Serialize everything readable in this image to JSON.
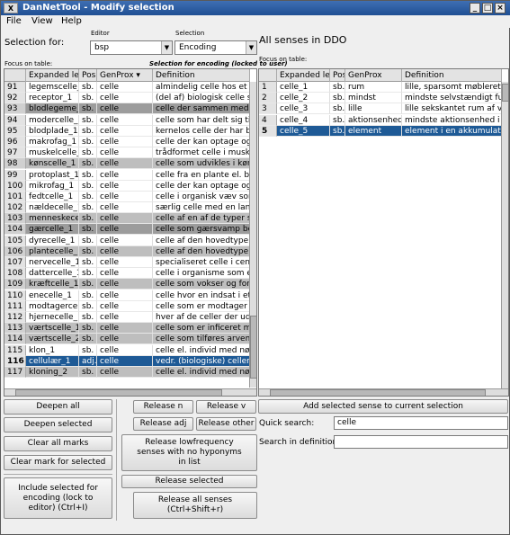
{
  "window": {
    "title": "DanNetTool - Modify selection"
  },
  "menu": [
    "File",
    "View",
    "Help"
  ],
  "left": {
    "selection_for_label": "Selection for:",
    "editor_label": "Editor",
    "editor_value": "bsp",
    "selection_label": "Selection",
    "selection_value": "Encoding",
    "focus_label": "Focus on table:",
    "lock_label": "Selection for encoding (locked to user)",
    "columns": [
      "",
      "Expanded le",
      "Pos",
      "GenProx",
      "Definition"
    ],
    "rows": [
      {
        "n": "91",
        "exp": "legemscelle_1",
        "pos": "sb.",
        "gen": "celle",
        "def": "almindelig celle hos et mer",
        "st": ""
      },
      {
        "n": "92",
        "exp": "receptor_1",
        "pos": "sb.",
        "gen": "celle",
        "def": "(del af) biologisk celle som",
        "st": ""
      },
      {
        "n": "93",
        "exp": "blodlegeme_1",
        "pos": "sb.",
        "gen": "celle",
        "def": "celle der sammen med blo",
        "st": "d"
      },
      {
        "n": "94",
        "exp": "modercelle_1",
        "pos": "sb.",
        "gen": "celle",
        "def": "celle som har delt sig til ny",
        "st": ""
      },
      {
        "n": "95",
        "exp": "blodplade_1",
        "pos": "sb.",
        "gen": "celle",
        "def": "kernelos celle der har bety",
        "st": ""
      },
      {
        "n": "96",
        "exp": "makrofag_1",
        "pos": "sb.",
        "gen": "celle",
        "def": "celle der kan optage og fje",
        "st": ""
      },
      {
        "n": "97",
        "exp": "muskelcelle_1",
        "pos": "sb.",
        "gen": "celle",
        "def": "trådformet celle i muskelv",
        "st": ""
      },
      {
        "n": "98",
        "exp": "kønscelle_1",
        "pos": "sb.",
        "gen": "celle",
        "def": "celle som udvikles i kønski",
        "st": "g"
      },
      {
        "n": "99",
        "exp": "protoplast_1",
        "pos": "sb.",
        "gen": "celle",
        "def": "celle fra en plante el. bakte",
        "st": ""
      },
      {
        "n": "100",
        "exp": "mikrofag_1",
        "pos": "sb.",
        "gen": "celle",
        "def": "celle der kan optage og us",
        "st": ""
      },
      {
        "n": "101",
        "exp": "fedtcelle_1",
        "pos": "sb.",
        "gen": "celle",
        "def": "celle i organisk væv som k",
        "st": ""
      },
      {
        "n": "102",
        "exp": "nældecelle_1",
        "pos": "sb.",
        "gen": "celle",
        "def": "særlig celle med en lang (c",
        "st": ""
      },
      {
        "n": "103",
        "exp": "menneskecel",
        "pos": "sb.",
        "gen": "celle",
        "def": "celle af en af de typer som",
        "st": "g"
      },
      {
        "n": "104",
        "exp": "gærcelle_1",
        "pos": "sb.",
        "gen": "celle",
        "def": "celle som gærsvamp bestå",
        "st": "d"
      },
      {
        "n": "105",
        "exp": "dyrecelle_1",
        "pos": "sb.",
        "gen": "celle",
        "def": "celle af den hovedtype som",
        "st": ""
      },
      {
        "n": "106",
        "exp": "plantecelle_1",
        "pos": "sb.",
        "gen": "celle",
        "def": "celle af den hovedtype som",
        "st": "g"
      },
      {
        "n": "107",
        "exp": "nervecelle_1",
        "pos": "sb.",
        "gen": "celle",
        "def": "specialiseret celle i centra",
        "st": ""
      },
      {
        "n": "108",
        "exp": "dattercelle_1",
        "pos": "sb.",
        "gen": "celle",
        "def": "celle i organisme som e",
        "st": ""
      },
      {
        "n": "109",
        "exp": "kræftcelle_1",
        "pos": "sb.",
        "gen": "celle",
        "def": "celle som vokser og forme",
        "st": "g"
      },
      {
        "n": "110",
        "exp": "enecelle_1",
        "pos": "sb.",
        "gen": "celle",
        "def": "celle hvor en indsat i et fo",
        "st": ""
      },
      {
        "n": "111",
        "exp": "modtagercelle",
        "pos": "sb.",
        "gen": "celle",
        "def": "celle som er modtager af a",
        "st": ""
      },
      {
        "n": "112",
        "exp": "hjernecelle_1",
        "pos": "sb.",
        "gen": "celle",
        "def": "hver af de celler der udgø",
        "st": ""
      },
      {
        "n": "113",
        "exp": "værtscelle_1",
        "pos": "sb.",
        "gen": "celle",
        "def": "celle som er inficeret med",
        "st": "g"
      },
      {
        "n": "114",
        "exp": "værtscelle_2",
        "pos": "sb.",
        "gen": "celle",
        "def": "celle som tilføres arvemate",
        "st": "g"
      },
      {
        "n": "115",
        "exp": "klon_1",
        "pos": "sb.",
        "gen": "celle",
        "def": "celle el. individ med nøjagt",
        "st": ""
      },
      {
        "n": "116",
        "exp": "cellulær_1",
        "pos": "adj.",
        "gen": "celle",
        "def": "vedr. (biologiske) celler",
        "st": "s"
      },
      {
        "n": "117",
        "exp": "kloning_2",
        "pos": "sb.",
        "gen": "celle",
        "def": "celle el. individ med nøjagt",
        "st": "g"
      }
    ]
  },
  "right": {
    "title": "All senses in DDO",
    "focus_label": "Focus on table:",
    "columns": [
      "",
      "Expanded le",
      "Pos",
      "GenProx",
      "Definition"
    ],
    "rows": [
      {
        "n": "1",
        "exp": "celle_1",
        "pos": "sb.",
        "gen": "rum",
        "def": "lille, sparsomt møbleret rum b",
        "st": ""
      },
      {
        "n": "2",
        "exp": "celle_2",
        "pos": "sb.",
        "gen": "mindst",
        "def": "mindste selvstændigt fungere",
        "st": ""
      },
      {
        "n": "3",
        "exp": "celle_3",
        "pos": "sb.",
        "gen": "lille",
        "def": "lille sekskantet rum af voks i",
        "st": ""
      },
      {
        "n": "4",
        "exp": "celle_4",
        "pos": "sb.",
        "gen": "aktionsenhed",
        "def": "mindste aktionsenhed i en or",
        "st": ""
      },
      {
        "n": "5",
        "exp": "celle_5",
        "pos": "sb.",
        "gen": "element",
        "def": "element i en akkumulator el.",
        "st": "s"
      }
    ]
  },
  "buttons": {
    "deepen_all": "Deepen all",
    "deepen_selected": "Deepen selected",
    "clear_all_marks": "Clear all marks",
    "clear_mark_selected": "Clear mark for selected",
    "include_selected": "Include selected for encoding (lock to editor) (Ctrl+I)",
    "release_n": "Release n",
    "release_v": "Release v",
    "release_adj": "Release adj",
    "release_other": "Release other",
    "release_lowfreq": "Release lowfrequency senses with no hyponyms in list",
    "release_selected": "Release selected",
    "release_all": "Release all senses (Ctrl+Shift+r)",
    "add_selected_sense": "Add selected sense to current selection"
  },
  "search": {
    "quick_label": "Quick search:",
    "quick_value": "celle",
    "definition_label": "Search in definition:",
    "definition_value": ""
  }
}
